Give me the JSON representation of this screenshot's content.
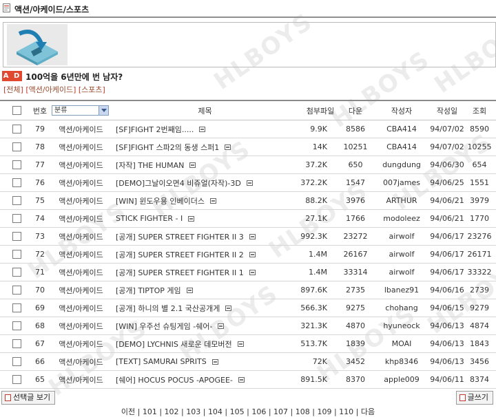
{
  "board": {
    "title": "액션/아케이드/스포츠",
    "watermark": "HLBOYS"
  },
  "headline": {
    "badge": "A D",
    "text": "100억을 6년만에 번 남자?"
  },
  "category_nav": {
    "open": "[",
    "close": "]",
    "items": [
      "전체",
      "액션/아케이드",
      "스포츠"
    ]
  },
  "columns": {
    "number": "번호",
    "category_select": "분류",
    "subject": "제목",
    "attachment": "첨부파일",
    "downloads": "다운",
    "author": "작성자",
    "date": "작성일",
    "views": "조회"
  },
  "posts": [
    {
      "no": "79",
      "category": "액션/아케이드",
      "subject": "[SF]FIGHT 2번째임.....",
      "size": "9.9K",
      "downloads": "8586",
      "author": "CBA414",
      "date": "94/07/02",
      "views": "8590"
    },
    {
      "no": "78",
      "category": "액션/아케이드",
      "subject": "[SF]FIGHT 스파2의 동생 스퍼1",
      "size": "14K",
      "downloads": "10251",
      "author": "CBA414",
      "date": "94/07/02",
      "views": "10255"
    },
    {
      "no": "77",
      "category": "액션/아케이드",
      "subject": "[자작] THE HUMAN",
      "size": "37.2K",
      "downloads": "650",
      "author": "dungdung",
      "date": "94/06/30",
      "views": "654"
    },
    {
      "no": "76",
      "category": "액션/아케이드",
      "subject": "[DEMO]그날이오면4 비쥬얼(자작)-3D",
      "size": "372.2K",
      "downloads": "1547",
      "author": "007james",
      "date": "94/06/25",
      "views": "1551"
    },
    {
      "no": "75",
      "category": "액션/아케이드",
      "subject": "[WIN] 윈도우용 인베이더스",
      "size": "88.2K",
      "downloads": "3976",
      "author": "ARTHUR",
      "date": "94/06/21",
      "views": "3979"
    },
    {
      "no": "74",
      "category": "액션/아케이드",
      "subject": "STICK FIGHTER - I",
      "size": "27.1K",
      "downloads": "1766",
      "author": "modoleez",
      "date": "94/06/21",
      "views": "1770"
    },
    {
      "no": "73",
      "category": "액션/아케이드",
      "subject": "[공개] SUPER STREET FIGHTER II 3",
      "size": "992.3K",
      "downloads": "23272",
      "author": "airwolf",
      "date": "94/06/17",
      "views": "23276"
    },
    {
      "no": "72",
      "category": "액션/아케이드",
      "subject": "[공개] SUPER STREET FIGHTER II 2",
      "size": "1.4M",
      "downloads": "26167",
      "author": "airwolf",
      "date": "94/06/17",
      "views": "26171"
    },
    {
      "no": "71",
      "category": "액션/아케이드",
      "subject": "[공개] SUPER STREET FIGHTER II 1",
      "size": "1.4M",
      "downloads": "33314",
      "author": "airwolf",
      "date": "94/06/17",
      "views": "33322"
    },
    {
      "no": "70",
      "category": "액션/아케이드",
      "subject": "[공개] TIPTOP 게임",
      "size": "897.6K",
      "downloads": "2735",
      "author": "lbanez91",
      "date": "94/06/16",
      "views": "2739"
    },
    {
      "no": "69",
      "category": "액션/아케이드",
      "subject": "[공개] 하니의 별 2.1 국산공개게",
      "size": "566.3K",
      "downloads": "9275",
      "author": "chohang",
      "date": "94/06/15",
      "views": "9279"
    },
    {
      "no": "68",
      "category": "액션/아케이드",
      "subject": "[WIN] 우주선 슈팅게임 -쉐어-",
      "size": "321.3K",
      "downloads": "4870",
      "author": "hyuneock",
      "date": "94/06/13",
      "views": "4874"
    },
    {
      "no": "67",
      "category": "액션/아케이드",
      "subject": "[DEMO] LYCHNIS 새로운 데모버전",
      "size": "513.7K",
      "downloads": "1839",
      "author": "MOAI",
      "date": "94/06/13",
      "views": "1843"
    },
    {
      "no": "66",
      "category": "액션/아케이드",
      "subject": "[TEXT] SAMURAI SPRITS",
      "size": "72K",
      "downloads": "3452",
      "author": "khp8346",
      "date": "94/06/13",
      "views": "3456"
    },
    {
      "no": "65",
      "category": "액션/아케이드",
      "subject": "[쉐어] HOCUS POCUS -APOGEE-",
      "size": "891.5K",
      "downloads": "8370",
      "author": "apple009",
      "date": "94/06/11",
      "views": "8374"
    }
  ],
  "footer": {
    "view_selected": "선택글 보기",
    "write": "글쓰기",
    "pager_prev": "이전",
    "pages": [
      "101",
      "102",
      "103",
      "104",
      "105",
      "106",
      "107",
      "108",
      "109",
      "110"
    ],
    "pager_next": "다음"
  },
  "colors": {
    "ad_badge": "#e0492f",
    "nav_link": "#9a4a2e",
    "select_border": "#7f9db9"
  }
}
